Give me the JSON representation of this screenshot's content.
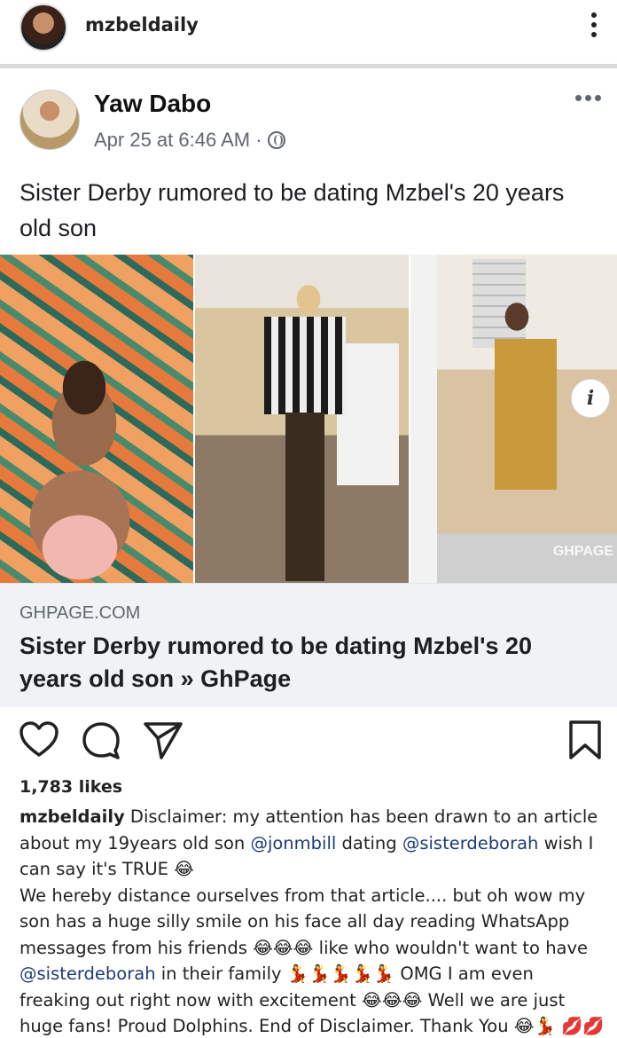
{
  "instagram": {
    "username": "mzbeldaily",
    "likes": "1,783 likes"
  },
  "fb_post": {
    "author": "Yaw Dabo",
    "timestamp": "Apr 25 at 6:46 AM ·",
    "text": "Sister Derby rumored to be dating Mzbel's 20 years old son",
    "link_domain": "GHPAGE.COM",
    "link_title": "Sister Derby rumored to be dating Mzbel's 20 years old son » GhPage",
    "watermark": "GHPAGE",
    "info_label": "i"
  },
  "caption": {
    "user": "mzbeldaily",
    "p1": " Disclaimer: my attention has been drawn to an article about my 19years old son ",
    "mention1": "@jonmbill",
    "p2": " dating ",
    "mention2": "@sisterdeborah",
    "p3": " wish I can say it's TRUE 😂",
    "p4": "We hereby distance ourselves from that article.... but oh wow my son has a huge silly smile on his face all day  reading WhatsApp messages from his friends 😂😂😂 like who wouldn't want to have ",
    "mention3": "@sisterdeborah",
    "p5": " in their family 💃💃💃💃💃 OMG I am even freaking out right now with excitement 😂😂😂 Well we are just huge fans! Proud Dolphins. End of Disclaimer. Thank You 😂💃 💋💋💋"
  }
}
